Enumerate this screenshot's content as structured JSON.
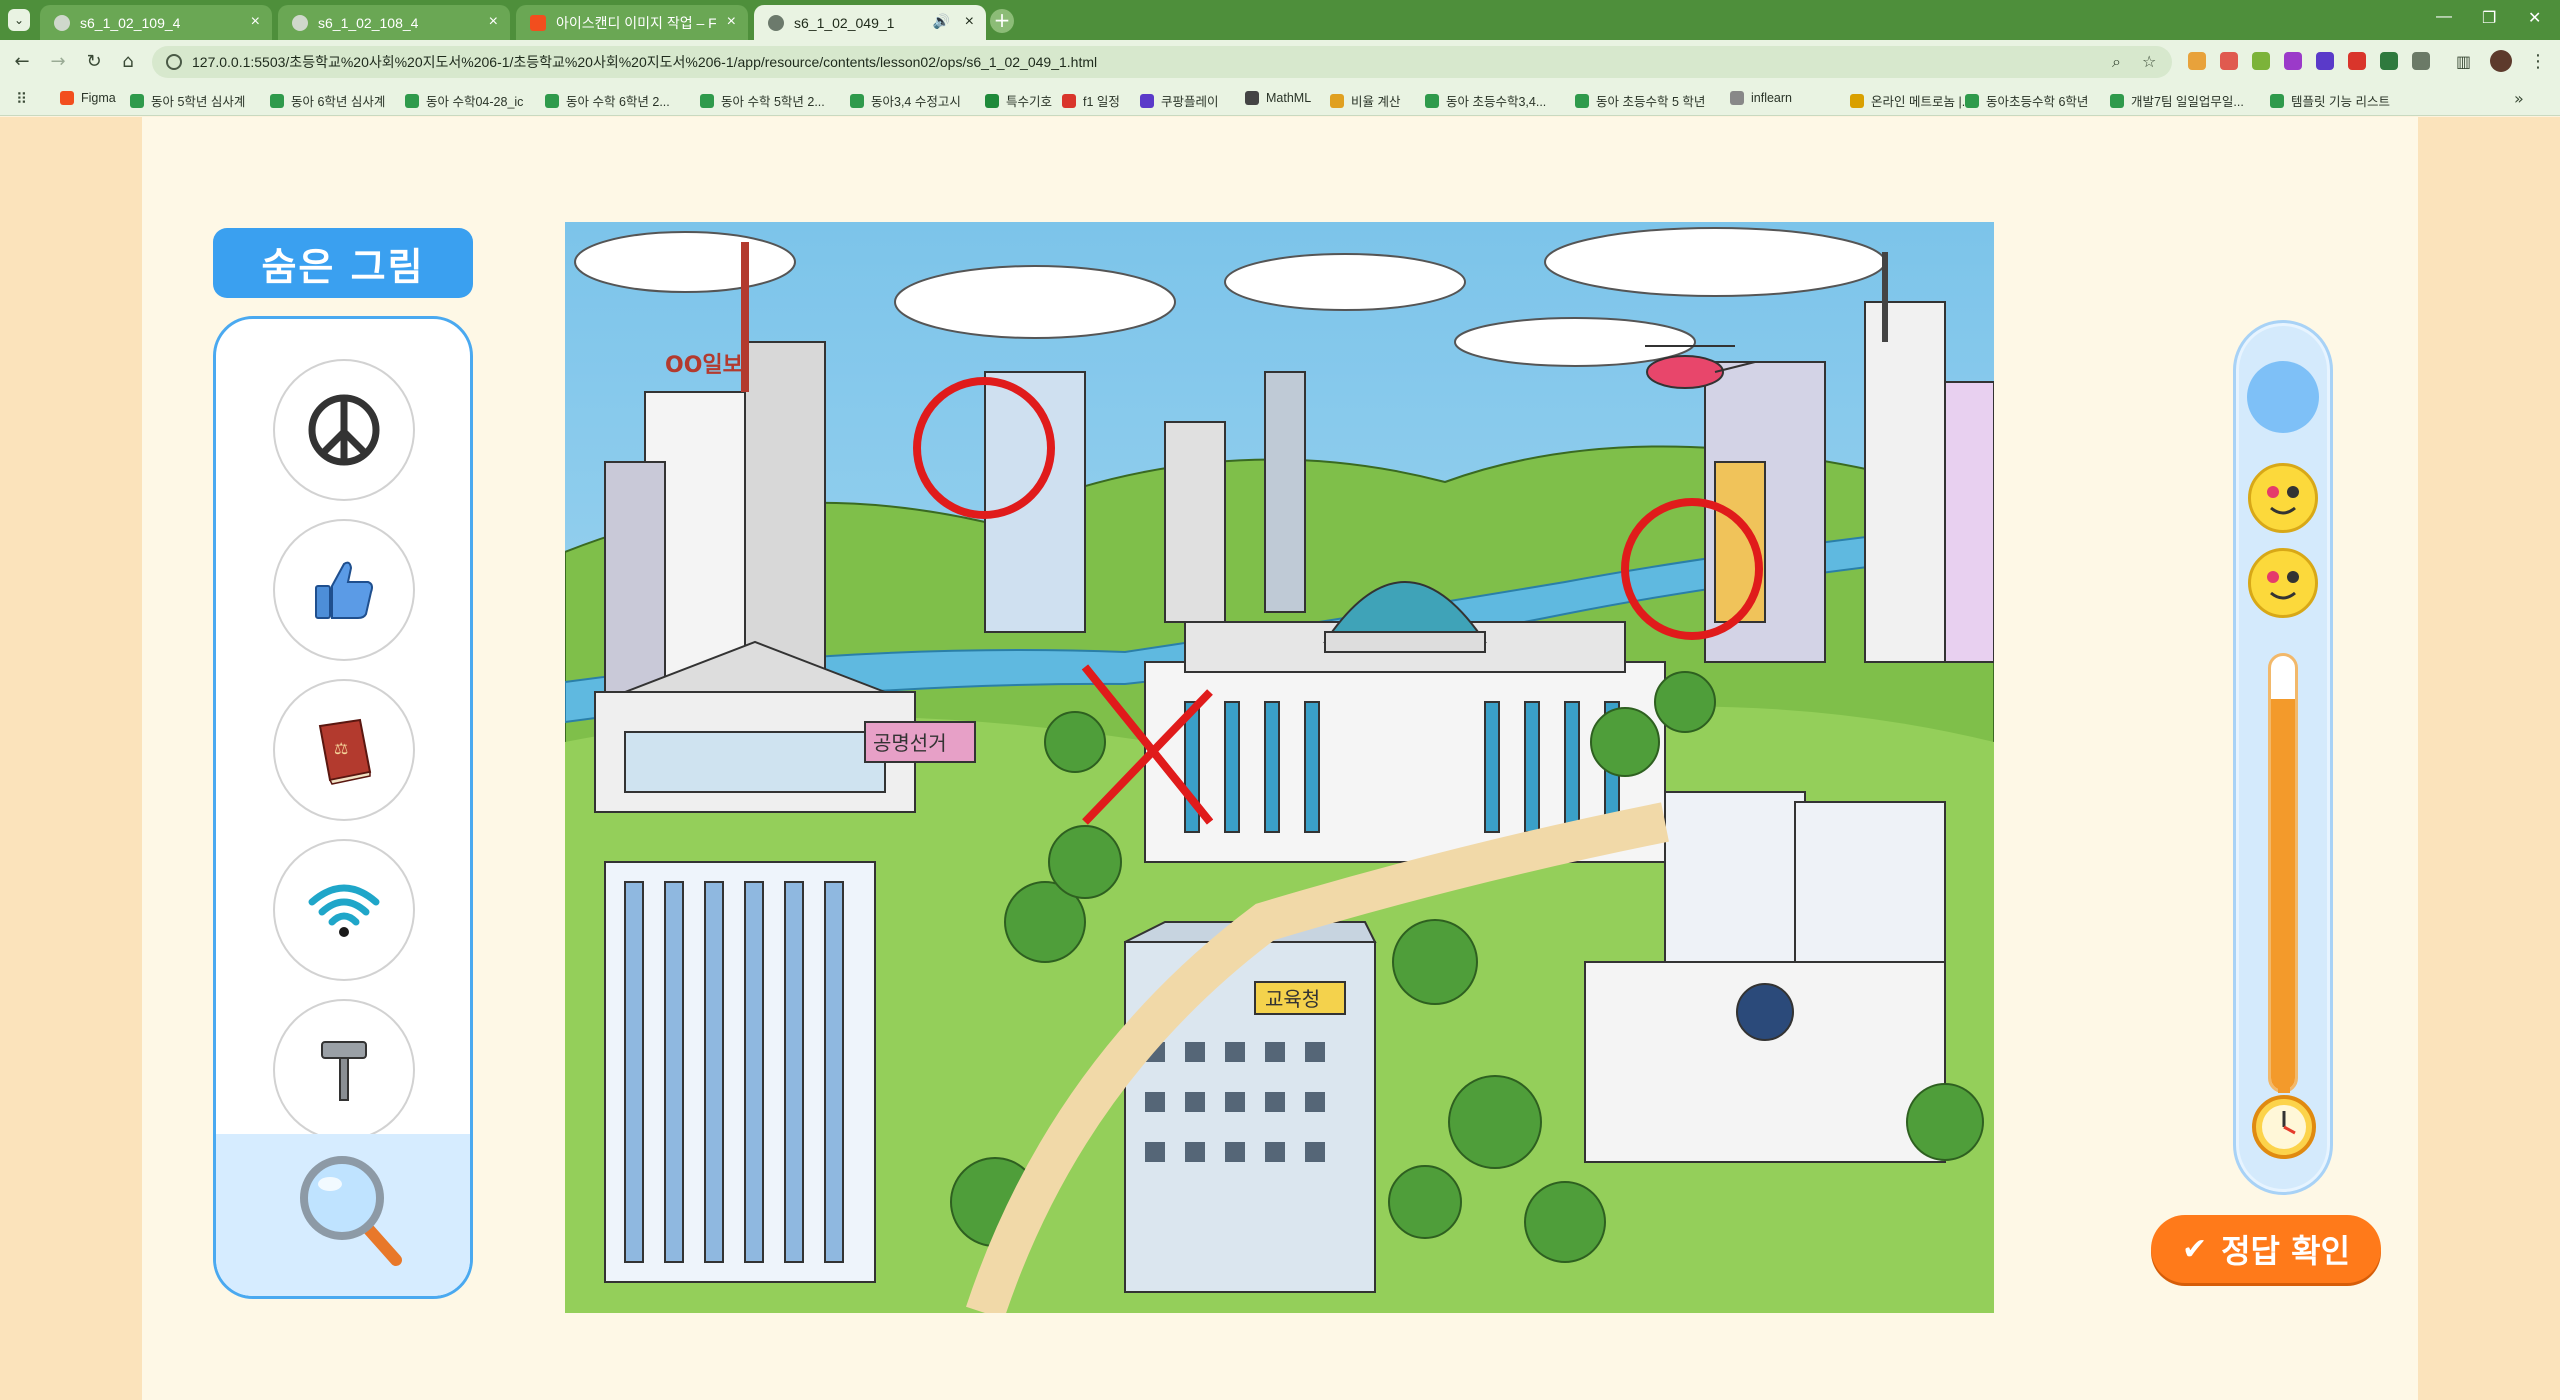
{
  "browser": {
    "tabs": [
      {
        "label": "s6_1_02_109_4",
        "active": false
      },
      {
        "label": "s6_1_02_108_4",
        "active": false
      },
      {
        "label": "아이스캔디 이미지 작업 – Figma",
        "active": false
      },
      {
        "label": "s6_1_02_049_1",
        "active": true
      }
    ],
    "new_tab": "+",
    "window_controls": [
      "—",
      "❐",
      "✕"
    ],
    "url": "127.0.0.1:5503/초등학교%20사회%20지도서%206-1/초등학교%20사회%20지도서%206-1/app/resource/contents/lesson02/ops/s6_1_02_049_1.html",
    "bookmarks": [
      "Figma",
      "동아 5학년 심사계",
      "동아 6학년 심사계",
      "동아 수학04-28_ic",
      "동아 수학 6학년 2...",
      "동아 수학 5학년 2...",
      "동아3,4 수정고시",
      "특수기호",
      "f1 일정",
      "쿠팡플레이",
      "MathML",
      "비율 계산",
      "동아 초등수학3,4...",
      "동아 초등수학 5 학년",
      "inflearn",
      "온라인 메트로놈 |...",
      "동아초등수학 6학년",
      "개발7팀 일일업무일...",
      "템플릿 기능 리스트"
    ],
    "more_bookmarks": "»"
  },
  "page": {
    "title": "숨은 그림",
    "items": [
      {
        "icon": "peace-sign-icon",
        "found": false
      },
      {
        "icon": "thumbs-up-icon",
        "found": false
      },
      {
        "icon": "law-book-icon",
        "found": false
      },
      {
        "icon": "wifi-icon",
        "found": false
      },
      {
        "icon": "gavel-icon",
        "found": false
      }
    ],
    "hint_icon": "magnifier-icon",
    "scene_sign": "공명선거",
    "scene_building_sign": "교육청",
    "scene_logo_sign": "OO일보",
    "lives": 2,
    "timer_fraction": 0.9,
    "check_button": "정답 확인"
  },
  "colors": {
    "accent_blue": "#3aa0f0",
    "check_orange": "#ff7a1a",
    "mark_red": "#e01b1b",
    "tab_green": "#4e8f3b"
  }
}
